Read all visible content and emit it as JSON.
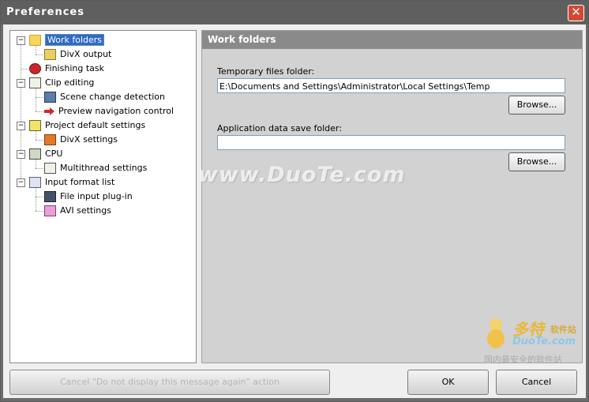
{
  "window": {
    "title": "Preferences",
    "close_glyph": "✕"
  },
  "tree": {
    "items": [
      {
        "label": "Work folders",
        "icon": "folder-icon",
        "selected": true
      },
      {
        "label": "DivX output",
        "icon": "divx-output-icon"
      },
      {
        "label": "Finishing task",
        "icon": "finishing-task-icon"
      },
      {
        "label": "Clip editing",
        "icon": "clip-editing-icon"
      },
      {
        "label": "Scene change detection",
        "icon": "film-icon"
      },
      {
        "label": "Preview navigation control",
        "icon": "arrow-right-icon"
      },
      {
        "label": "Project default settings",
        "icon": "project-settings-icon"
      },
      {
        "label": "DivX settings",
        "icon": "divx-settings-icon"
      },
      {
        "label": "CPU",
        "icon": "cpu-icon"
      },
      {
        "label": "Multithread settings",
        "icon": "multithread-icon"
      },
      {
        "label": "Input format list",
        "icon": "list-icon"
      },
      {
        "label": "File input plug-in",
        "icon": "plugin-icon"
      },
      {
        "label": "AVI settings",
        "icon": "avi-icon"
      }
    ],
    "expander_glyph": "−"
  },
  "panel": {
    "header": "Work folders",
    "temp_label": "Temporary files folder:",
    "temp_value": "E:\\Documents and Settings\\Administrator\\Local Settings\\Temp",
    "browse1": "Browse...",
    "appdata_label": "Application data save folder:",
    "appdata_value": "",
    "browse2": "Browse..."
  },
  "footer": {
    "cancel_notice": "Cancel \"Do not display this message again\" action",
    "ok": "OK",
    "cancel": "Cancel"
  },
  "watermark": {
    "text": "www.DuoTe.com",
    "logo_big": "多特",
    "logo_small": "软件站",
    "logo_url": "DuoTe.com",
    "logo_tag": "国内最安全的软件站"
  }
}
